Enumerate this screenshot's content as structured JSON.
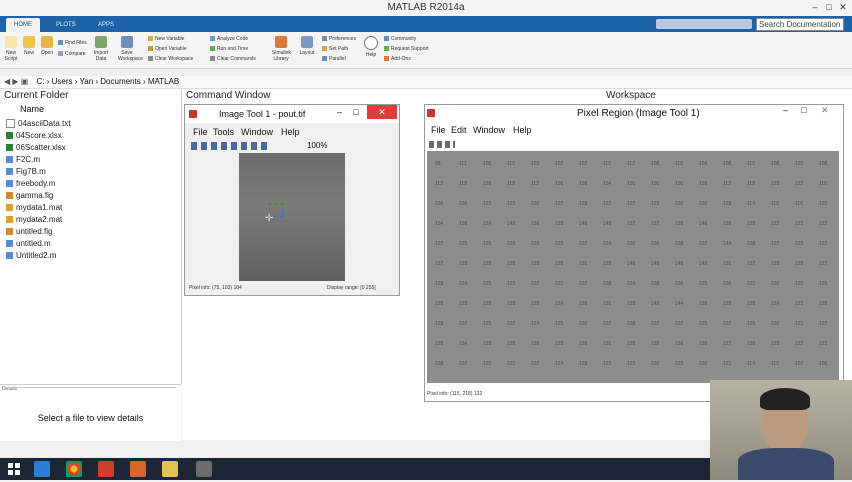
{
  "window": {
    "title": "MATLAB R2014a"
  },
  "tabs": [
    "HOME",
    "PLOTS",
    "APPS"
  ],
  "search": {
    "placeholder": "Search Documentation"
  },
  "ribbon": {
    "big": [
      "New Script",
      "New",
      "Open",
      "Compare",
      "Import Data",
      "Save Workspace",
      "Simulink Library",
      "Layout",
      "Help"
    ],
    "small": [
      "Find Files",
      "New Variable",
      "Open Variable",
      "Clear Workspace",
      "Analyze Code",
      "Run and Time",
      "Clear Commands",
      "Preferences",
      "Set Path",
      "Parallel",
      "Community",
      "Request Support",
      "Add-Ons"
    ]
  },
  "address": {
    "path": [
      "C:",
      "Users",
      "Yan",
      "Documents",
      "MATLAB"
    ]
  },
  "panels": {
    "current_folder": "Current Folder",
    "command_window": "Command Window",
    "workspace": "Workspace"
  },
  "files": {
    "header": "Name",
    "items": [
      "04asciiData.txt",
      "04Score.xlsx",
      "06Scatter.xlsx",
      "F2C.m",
      "Fig7B.m",
      "freebody.m",
      "gamma.fig",
      "mydata1.mat",
      "mydata2.mat",
      "untitled.fig",
      "untitled.m",
      "Untitled2.m"
    ]
  },
  "details": {
    "label": "Details",
    "empty": "Select a file to view details"
  },
  "image_tool": {
    "title": "Image Tool 1 - pout.tif",
    "menu": [
      "File",
      "Tools",
      "Window",
      "Help"
    ],
    "zoom": "100%",
    "pixel_info": "Pixel info: (75, 103)  104",
    "display_range": "Display range: [0 255]"
  },
  "pixel_region": {
    "title": "Pixel Region (Image Tool 1)",
    "menu": [
      "File",
      "Edit",
      "Window",
      "Help"
    ],
    "pixel_info": "Pixel info: (115, 218)  132",
    "rows": [
      [
        "98",
        "111",
        "105",
        "110",
        "103",
        "102",
        "102",
        "110",
        "112",
        "108",
        "118",
        "104",
        "108",
        "110",
        "108",
        "120",
        "108"
      ],
      [
        "113",
        "118",
        "126",
        "118",
        "112",
        "106",
        "108",
        "104",
        "101",
        "100",
        "100",
        "109",
        "113",
        "118",
        "123",
        "122",
        "110"
      ],
      [
        "136",
        "136",
        "123",
        "123",
        "130",
        "127",
        "128",
        "122",
        "127",
        "129",
        "130",
        "130",
        "128",
        "114",
        "118",
        "116",
        "120"
      ],
      [
        "104",
        "108",
        "124",
        "142",
        "136",
        "133",
        "140",
        "143",
        "137",
        "137",
        "138",
        "146",
        "139",
        "129",
        "122",
        "121",
        "122"
      ],
      [
        "127",
        "135",
        "126",
        "139",
        "139",
        "133",
        "132",
        "134",
        "130",
        "136",
        "138",
        "132",
        "144",
        "138",
        "127",
        "133",
        "122"
      ],
      [
        "137",
        "133",
        "129",
        "128",
        "133",
        "128",
        "131",
        "129",
        "140",
        "149",
        "148",
        "142",
        "131",
        "137",
        "133",
        "129",
        "127"
      ],
      [
        "128",
        "134",
        "135",
        "123",
        "132",
        "131",
        "132",
        "138",
        "134",
        "138",
        "136",
        "135",
        "136",
        "131",
        "130",
        "120",
        "126"
      ],
      [
        "128",
        "123",
        "129",
        "133",
        "129",
        "124",
        "126",
        "131",
        "133",
        "142",
        "144",
        "139",
        "129",
        "128",
        "124",
        "121",
        "120"
      ],
      [
        "128",
        "137",
        "125",
        "132",
        "124",
        "125",
        "130",
        "132",
        "138",
        "132",
        "132",
        "135",
        "132",
        "126",
        "130",
        "121",
        "127"
      ],
      [
        "128",
        "134",
        "133",
        "125",
        "139",
        "123",
        "126",
        "131",
        "128",
        "132",
        "136",
        "130",
        "127",
        "130",
        "123",
        "122",
        "121"
      ],
      [
        "138",
        "137",
        "120",
        "131",
        "132",
        "124",
        "128",
        "123",
        "123",
        "130",
        "133",
        "130",
        "121",
        "114",
        "110",
        "107",
        "100"
      ]
    ]
  },
  "taskbar": {
    "apps": [
      "start",
      "explorer",
      "chrome",
      "powerpoint",
      "matlab",
      "folder",
      "desktop"
    ]
  },
  "colors": {
    "accent": "#1e63a8",
    "close": "#e03c3c"
  }
}
